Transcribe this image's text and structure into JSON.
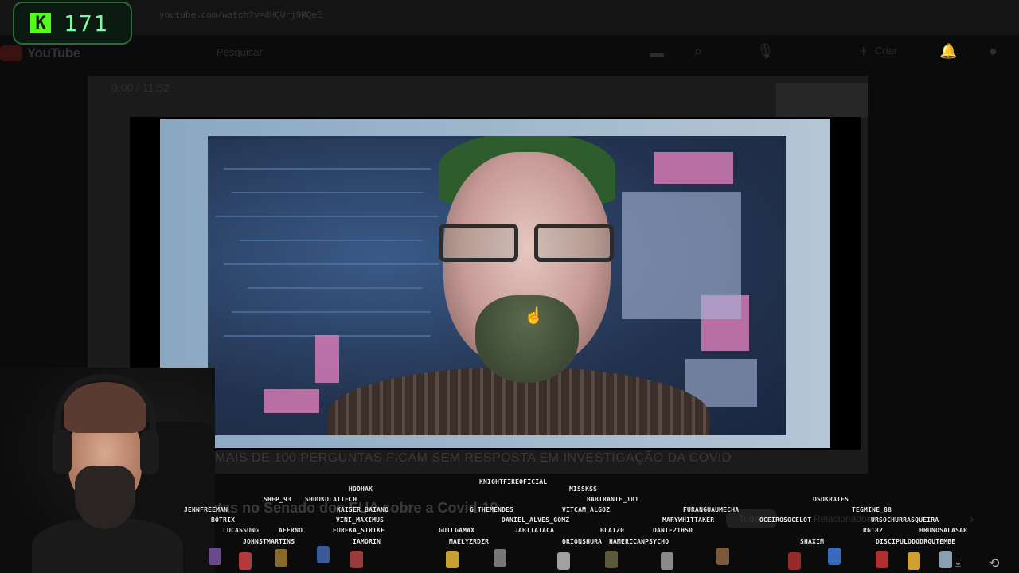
{
  "browser": {
    "url": "youtube.com/watch?v=dHQUrj9RQeE"
  },
  "youtube": {
    "logo_text": "YouTube",
    "search_placeholder": "Pesquisar",
    "create_label": "Criar",
    "player_time": "0:00 / 11:52",
    "video_caption": "MAIS DE 100 PERGUNTAS FICAM SEM RESPOSTA EM INVESTIGAÇÃO DA COVID",
    "video_title_partial": "se recusam a responder perguntas no Senado dos EUA sobre a Covid-19",
    "chip_all": "Todos",
    "chip_related": "Relacionados"
  },
  "overlay": {
    "viewer_count": "171"
  },
  "chat_names": [
    {
      "text": "KNIGHTFIREOFICIAL"
    },
    {
      "text": "MISSKSS"
    },
    {
      "text": "HODHAK"
    },
    {
      "text": "SHEP_93"
    },
    {
      "text": "SHOUKOLATTECH"
    },
    {
      "text": "BABIRANTE_101"
    },
    {
      "text": "OSOKRATES"
    },
    {
      "text": "JENNFREEMAN"
    },
    {
      "text": "KAISER_BAIANO"
    },
    {
      "text": "G_THEMENDES"
    },
    {
      "text": "VITCAM_ALGOZ"
    },
    {
      "text": "FURANGUAUMECHA"
    },
    {
      "text": "TEGMINE_88"
    },
    {
      "text": "BOTRIX"
    },
    {
      "text": "VINI_MAXIMUS"
    },
    {
      "text": "DANIEL_ALVES_GOMZ"
    },
    {
      "text": "MARYWHITTAKER"
    },
    {
      "text": "OCEIROSOCELOT"
    },
    {
      "text": "URSOCHURRASQUEIRA"
    },
    {
      "text": "LUCASSUNG"
    },
    {
      "text": "AFERNO"
    },
    {
      "text": "EUREKA_STRIKE"
    },
    {
      "text": "GUILGAMAX"
    },
    {
      "text": "JABITATACA"
    },
    {
      "text": "BLATZ0"
    },
    {
      "text": "DANTE21HS0"
    },
    {
      "text": "RG182"
    },
    {
      "text": "BRUNOSALASAR"
    },
    {
      "text": "JOHNSTMARTINS"
    },
    {
      "text": "IAMORIN"
    },
    {
      "text": "MAELYZRDZR"
    },
    {
      "text": "ORIONSHURA"
    },
    {
      "text": "HAMERICANPSYCHO"
    },
    {
      "text": "SHAXIM"
    },
    {
      "text": "DISCIPULODODRGUTEMBE"
    }
  ]
}
